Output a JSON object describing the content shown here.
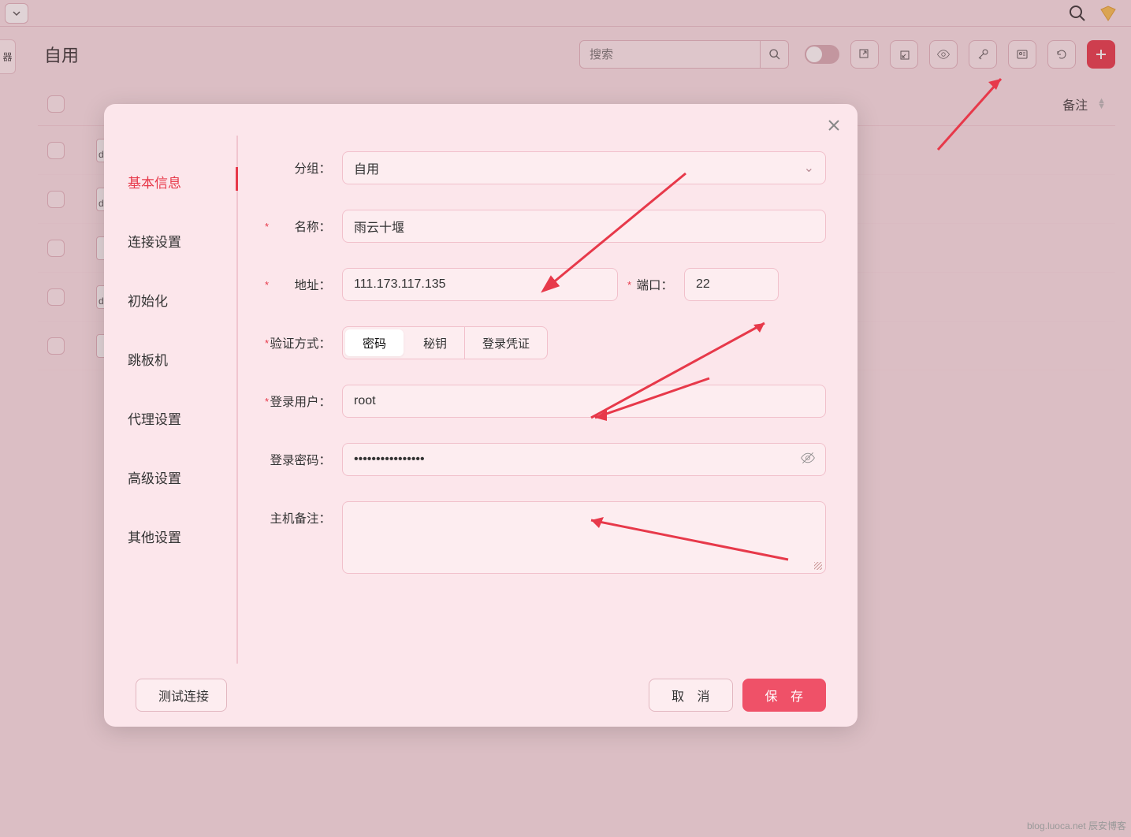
{
  "topbar": {
    "dropdown_icon": "chevron-down"
  },
  "header": {
    "side_tab": "器",
    "title": "自用",
    "search_placeholder": "搜索",
    "remark_label": "备注"
  },
  "list": {
    "rows": [
      {
        "label": "d"
      },
      {
        "label": "d"
      },
      {
        "label": ""
      },
      {
        "label": "d"
      },
      {
        "label": ""
      }
    ]
  },
  "modal": {
    "tabs": [
      "基本信息",
      "连接设置",
      "初始化",
      "跳板机",
      "代理设置",
      "高级设置",
      "其他设置"
    ],
    "active_tab": 0,
    "form": {
      "group_label": "分组：",
      "group_value": "自用",
      "name_label": "名称：",
      "name_value": "雨云十堰",
      "addr_label": "地址：",
      "addr_value": "111.173.117.135",
      "port_label": "端口：",
      "port_value": "22",
      "auth_label": "验证方式：",
      "auth_options": [
        "密码",
        "秘钥",
        "登录凭证"
      ],
      "auth_active": 0,
      "user_label": "登录用户：",
      "user_value": "root",
      "pwd_label": "登录密码：",
      "pwd_value": "••••••••••••••••",
      "remark_label": "主机备注：",
      "remark_value": ""
    },
    "footer": {
      "test_label": "测试连接",
      "cancel_label": "取 消",
      "save_label": "保 存"
    }
  },
  "watermark": "blog.luoca.net 辰安博客"
}
